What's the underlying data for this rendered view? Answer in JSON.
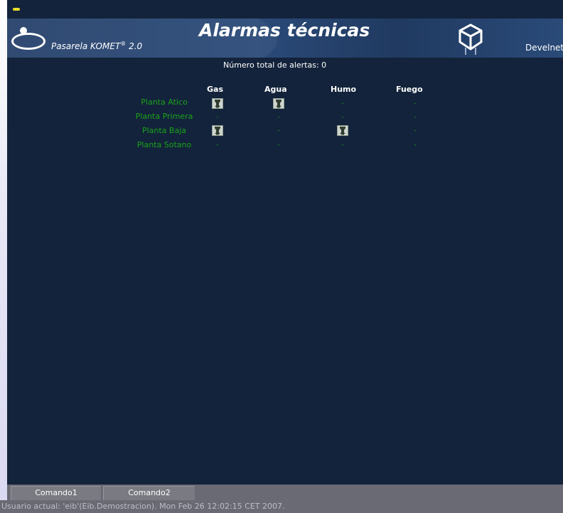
{
  "header": {
    "brand": "Pasarela KOMET",
    "brand_registered": "®",
    "brand_version": "2.0",
    "title": "Alarmas técnicas",
    "brand_right": "Develnet"
  },
  "summary": {
    "total_alerts": "Número total de alertas: 0"
  },
  "alarms": {
    "columns": [
      "Gas",
      "Agua",
      "Humo",
      "Fuego"
    ],
    "rows": [
      {
        "label": "Planta Atico",
        "cells": [
          "alarm",
          "alarm",
          "-",
          "-"
        ]
      },
      {
        "label": "Planta Primera",
        "cells": [
          "-",
          "-",
          "-",
          "-"
        ]
      },
      {
        "label": "Planta Baja",
        "cells": [
          "alarm",
          "-",
          "alarm",
          "-"
        ]
      },
      {
        "label": "Planta Sotano",
        "cells": [
          "-",
          "-",
          "-",
          "-"
        ]
      }
    ],
    "dash": "-",
    "alarm_icon": "alarm-bell-icon"
  },
  "commands": [
    "Comando1",
    "Comando2"
  ],
  "status": {
    "text": "Usuario actual: 'eib'(Eib.Demostracion). Mon Feb 26 12:02:15 CET 2007."
  },
  "colors": {
    "background": "#13233b",
    "header": "#2b4a78",
    "row_label": "#19a319",
    "bar": "#6a6a74"
  }
}
